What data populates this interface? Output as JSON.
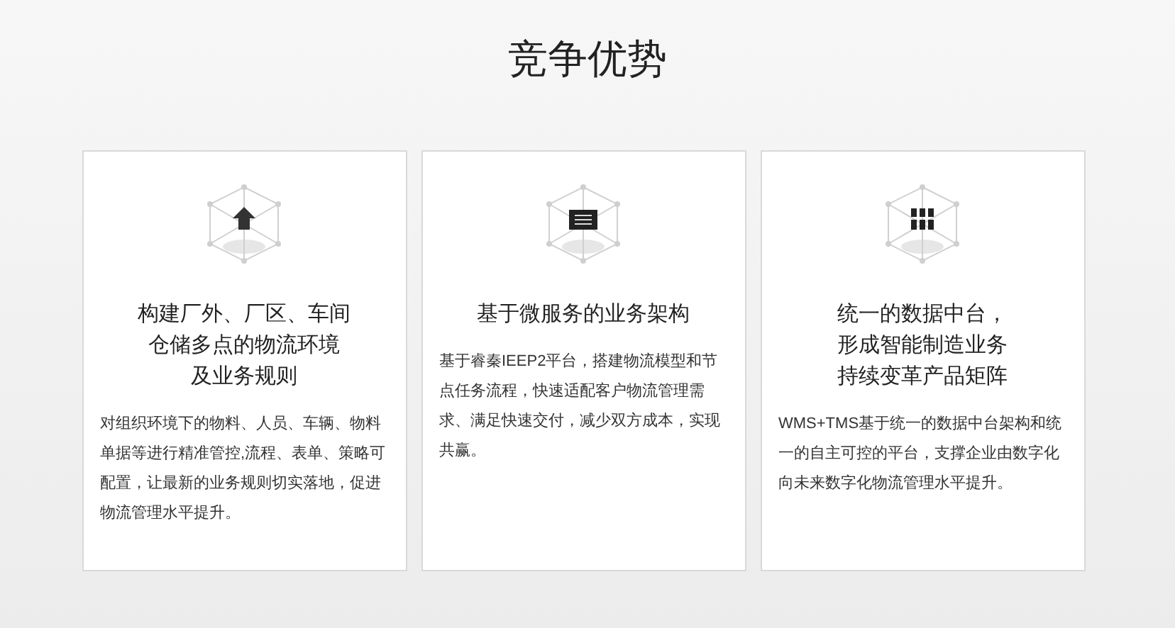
{
  "heading": "竞争优势",
  "cards": [
    {
      "kind": "upload",
      "title_lines": [
        "构建厂外、厂区、车间",
        "仓储多点的物流环境",
        "及业务规则"
      ],
      "body": "对组织环境下的物料、人员、车辆、物料单据等进行精准管控,流程、表单、策略可配置，让最新的业务规则切实落地，促进物流管理水平提升。"
    },
    {
      "kind": "list",
      "title_lines": [
        "基于微服务的业务架构"
      ],
      "body": "基于睿秦IEEP2平台，搭建物流模型和节点任务流程，快速适配客户物流管理需求、满足快速交付，减少双方成本，实现共赢。"
    },
    {
      "kind": "grid",
      "title_lines": [
        "统一的数据中台，",
        "形成智能制造业务",
        "持续变革产品矩阵"
      ],
      "body": "WMS+TMS基于统一的数据中台架构和统一的自主可控的平台，支撑企业由数字化向未来数字化物流管理水平提升。"
    }
  ]
}
